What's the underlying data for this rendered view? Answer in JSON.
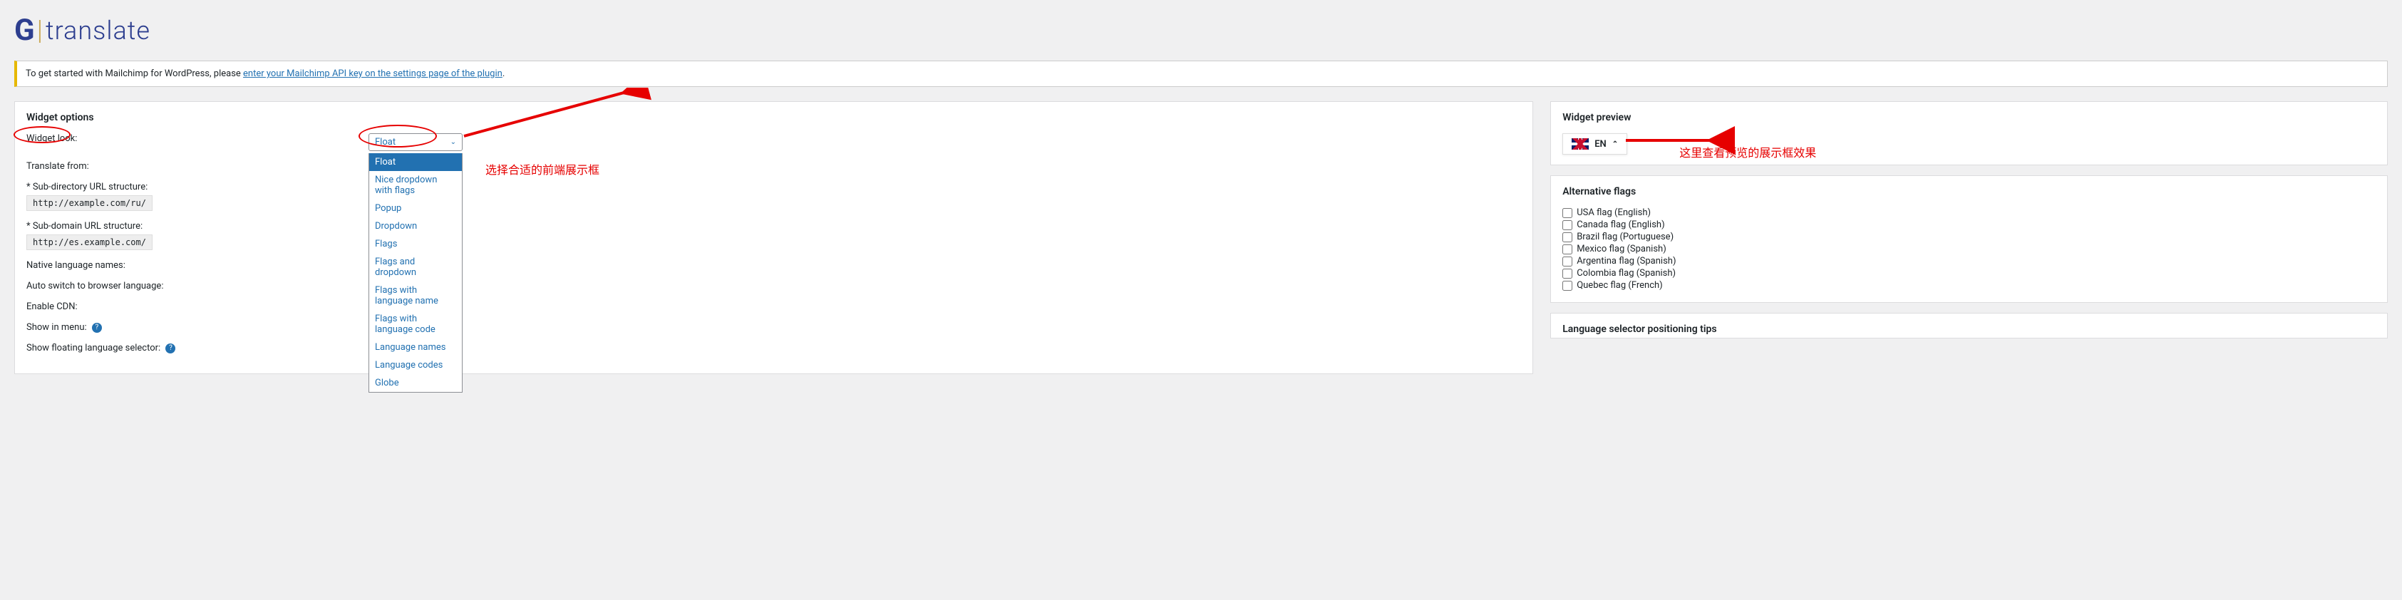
{
  "logo": {
    "g": "G",
    "text": "translate"
  },
  "notice": {
    "text": "To get started with Mailchimp for WordPress, please ",
    "link": "enter your Mailchimp API key on the settings page of the plugin",
    "suffix": "."
  },
  "widget_options": {
    "title": "Widget options",
    "widget_look": {
      "label": "Widget look:",
      "value": "Float"
    },
    "translate_from": {
      "label": "Translate from:"
    },
    "sub_dir": {
      "label": "* Sub-directory URL structure:",
      "code": "http://example.com/ru/"
    },
    "sub_domain": {
      "label": "* Sub-domain URL structure:",
      "code": "http://es.example.com/"
    },
    "native_names": {
      "label": "Native language names:"
    },
    "auto_switch": {
      "label": "Auto switch to browser language:"
    },
    "enable_cdn": {
      "label": "Enable CDN:"
    },
    "show_menu": {
      "label": "Show in menu:"
    },
    "show_floating": {
      "label": "Show floating language selector:"
    }
  },
  "dropdown_options": [
    "Float",
    "Nice dropdown with flags",
    "Popup",
    "Dropdown",
    "Flags",
    "Flags and dropdown",
    "Flags with language name",
    "Flags with language code",
    "Language names",
    "Language codes",
    "Globe"
  ],
  "annotations": {
    "select_text": "选择合适的前端展示框",
    "preview_text": "这里查看预览的展示框效果"
  },
  "widget_preview": {
    "title": "Widget preview",
    "lang": "EN"
  },
  "alt_flags": {
    "title": "Alternative flags",
    "items": [
      "USA flag (English)",
      "Canada flag (English)",
      "Brazil flag (Portuguese)",
      "Mexico flag (Spanish)",
      "Argentina flag (Spanish)",
      "Colombia flag (Spanish)",
      "Quebec flag (French)"
    ]
  },
  "lang_selector_tips": {
    "title": "Language selector positioning tips"
  }
}
